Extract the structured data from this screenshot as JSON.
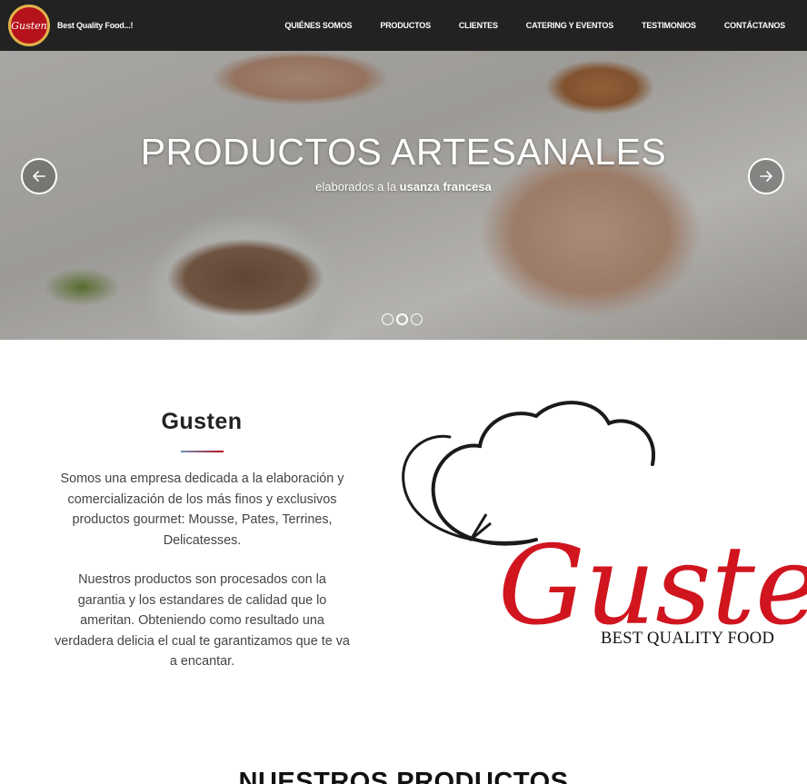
{
  "nav": {
    "logo_text": "Gusten",
    "brand": "Best Quality Food...!",
    "links": [
      "QUIÉNES SOMOS",
      "PRODUCTOS",
      "CLIENTES",
      "CATERING Y EVENTOS",
      "TESTIMONIOS",
      "CONTÁCTANOS"
    ]
  },
  "hero": {
    "title": "PRODUCTOS ARTESANALES",
    "subtitle_plain": "elaborados a la ",
    "subtitle_bold": "usanza francesa",
    "prev_icon": "arrow-left-icon",
    "next_icon": "arrow-right-icon",
    "slides": 3,
    "active_slide": 2
  },
  "about": {
    "title": "Gusten",
    "paragraph1": "Somos una empresa dedicada a la elaboración y comercialización de los más finos y exclusivos productos gourmet: Mousse, Pates, Terrines, Delicatesses.",
    "paragraph2": "Nuestros productos son procesados con la garantia y los estandares de calidad que lo ameritan. Obteniendo como resultado una verdadera delicia el cual te garantizamos que te va a encantar.",
    "logo_script": "Gusten",
    "logo_tagline": "BEST QUALITY FOOD"
  },
  "products": {
    "title": "NUESTROS PRODUCTOS"
  },
  "colors": {
    "navbar": "#222222",
    "brand_red": "#b5121b",
    "logo_red": "#d0151f",
    "divider_blue": "#6e8fb6"
  }
}
